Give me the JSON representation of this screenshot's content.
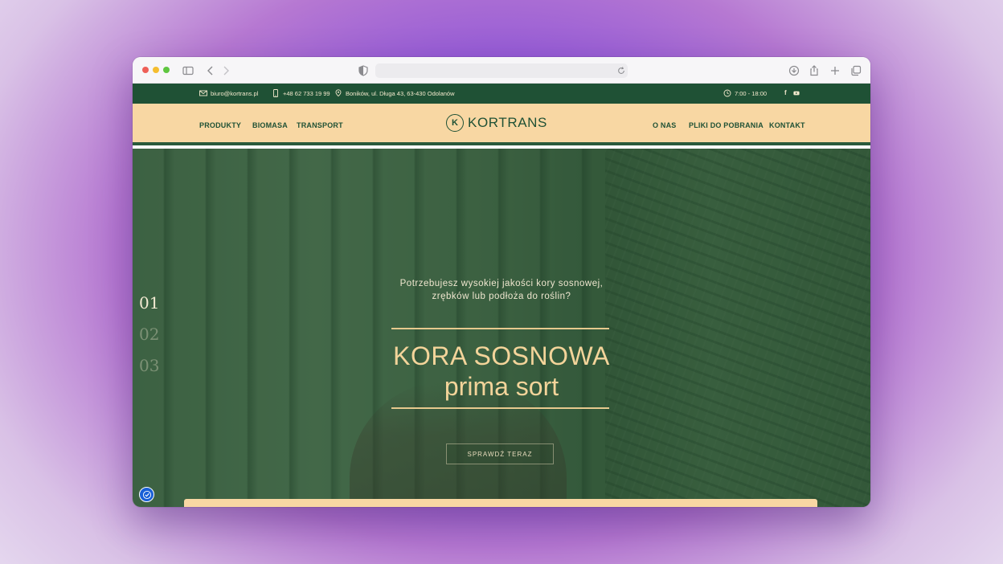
{
  "topbar": {
    "email": "biuro@kortrans.pl",
    "phone": "+48 62 733 19 99",
    "address": "Boników, ul. Długa 43, 63-430 Odolanów",
    "hours": "7:00 - 18:00",
    "social": [
      "facebook-icon",
      "youtube-icon"
    ]
  },
  "nav": {
    "left": [
      "PRODUKTY",
      "BIOMASA",
      "TRANSPORT"
    ],
    "logo": "KORTRANS",
    "logo_mark": "K",
    "right": [
      "O NAS",
      "PLIKI DO POBRANIA",
      "KONTAKT"
    ]
  },
  "hero": {
    "subtitle_line1": "Potrzebujesz wysokiej jakości kory sosnowej,",
    "subtitle_line2": "zrębków lub podłoża do roślin?",
    "title_line1": "KORA SOSNOWA",
    "title_line2": "prima sort",
    "cta": "SPRAWDŹ TERAZ",
    "slides": [
      "01",
      "02",
      "03"
    ],
    "active_slide": "01"
  },
  "colors": {
    "brand_green": "#1f5135",
    "brand_cream": "#f8d7a3",
    "accent_gold": "#f3d49a"
  }
}
